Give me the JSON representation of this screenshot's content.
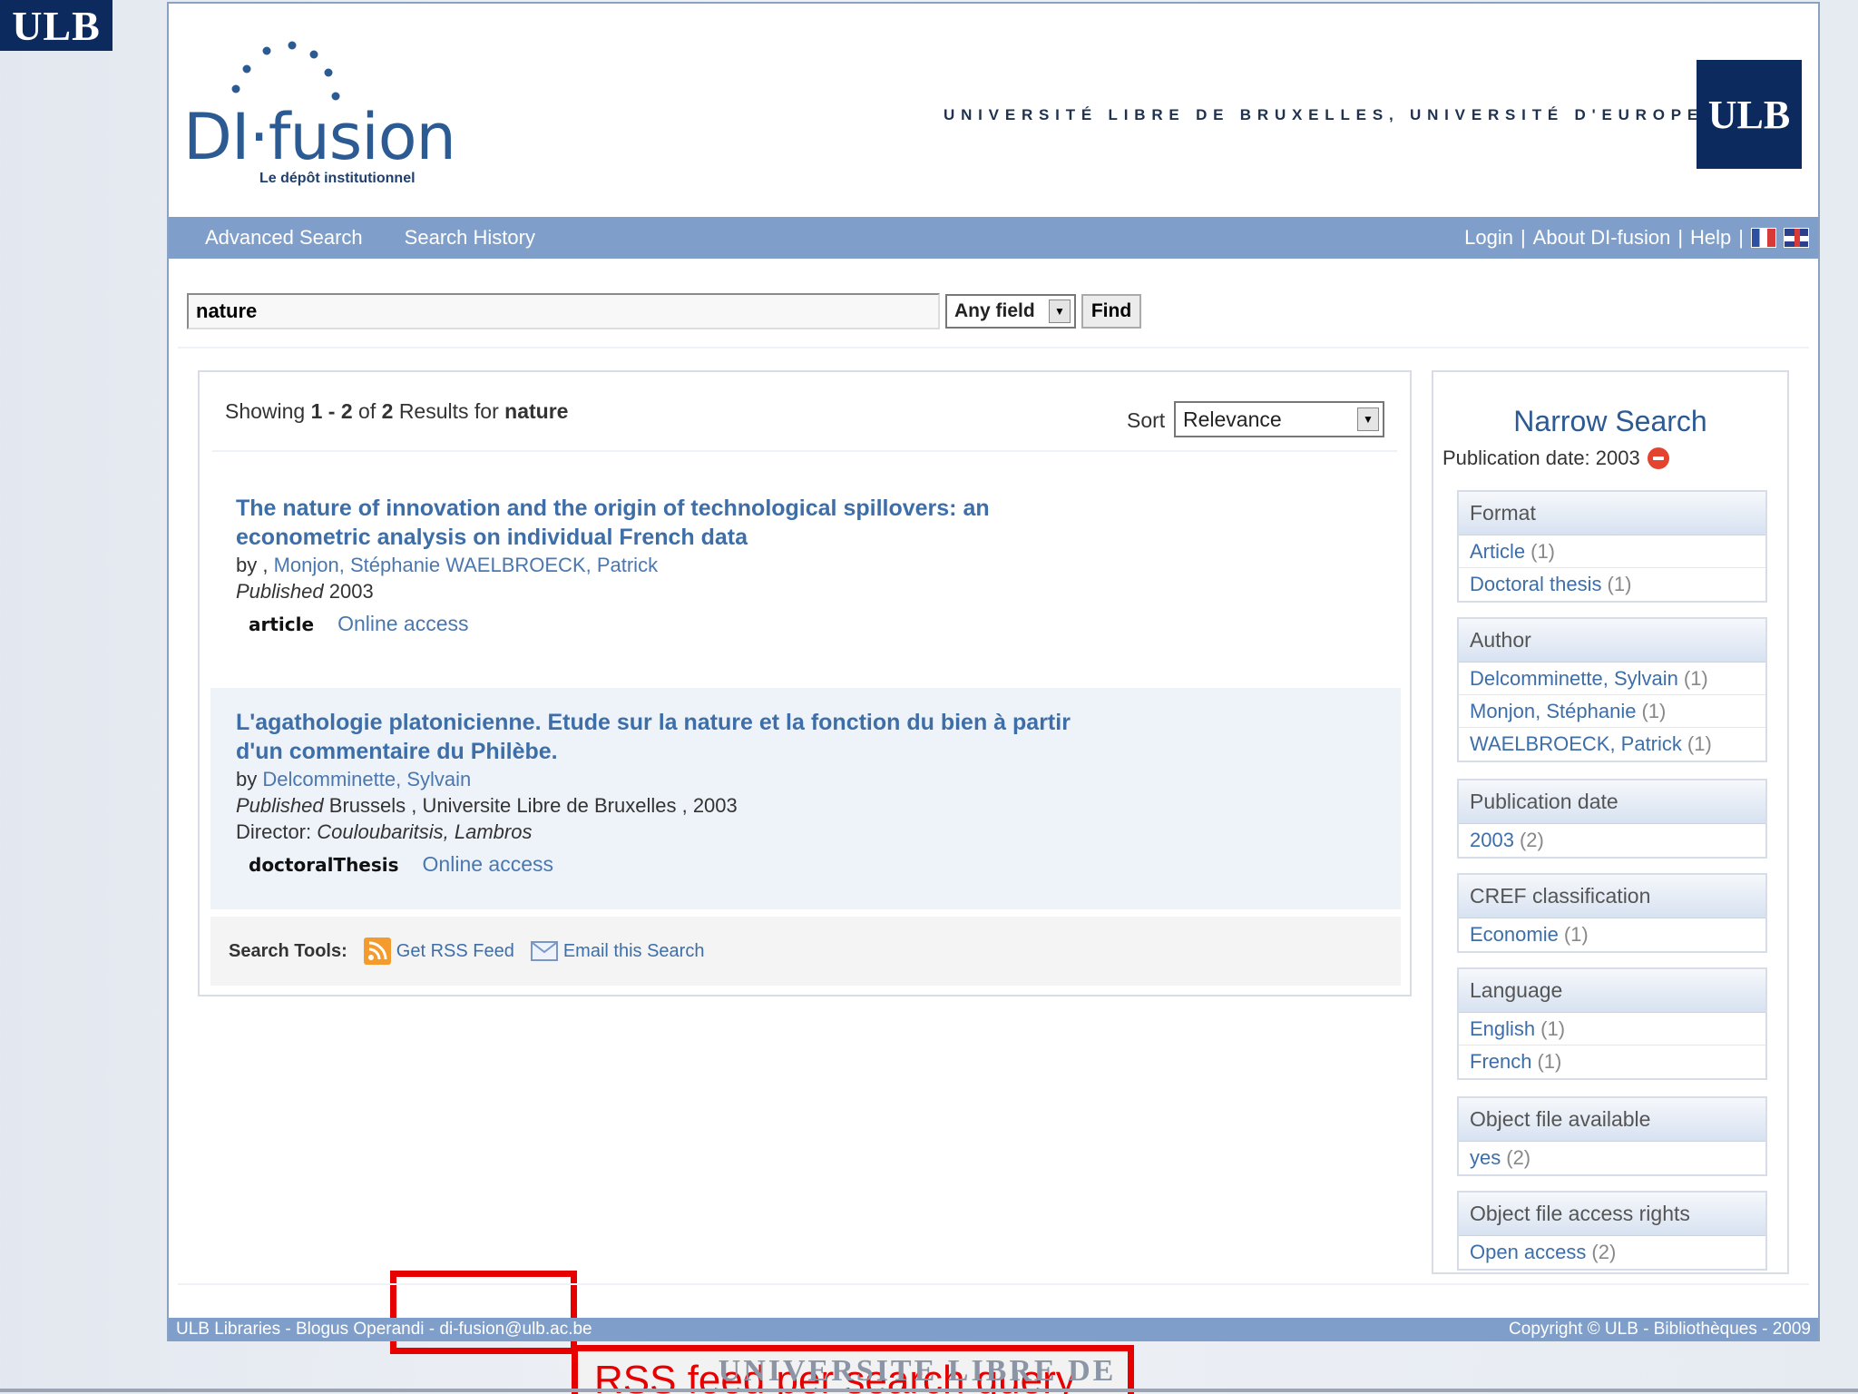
{
  "slide": {
    "corner_logo": "ULB",
    "bottom_text": "UNIVERSITE LIBRE DE BRUXELLES"
  },
  "header": {
    "brand_name": "DI·fusion",
    "brand_sub": "Le dépôt institutionnel",
    "university_text": "UNIVERSITÉ LIBRE DE BRUXELLES, UNIVERSITÉ D'EUROPE",
    "university_logo": "ULB"
  },
  "nav": {
    "left": [
      "Advanced Search",
      "Search History"
    ],
    "login": "Login",
    "about": "About DI-fusion",
    "help": "Help",
    "separator": "|"
  },
  "search": {
    "query": "nature",
    "field_select": "Any field",
    "find_label": "Find"
  },
  "results": {
    "showing_prefix": "Showing",
    "range": "1 - 2",
    "of_label": "of",
    "total": "2",
    "results_for": "Results for",
    "term": "nature",
    "sort_label": "Sort",
    "sort_value": "Relevance",
    "records": [
      {
        "title": "The nature of innovation and the origin of technological spillovers: an econometric analysis on individual French data",
        "by_label": "by ,",
        "authors": "Monjon, Stéphanie WAELBROECK, Patrick",
        "published_label": "Published",
        "published_value": "2003",
        "type": "article",
        "access": "Online access"
      },
      {
        "title": "L'agathologie platonicienne. Etude sur la nature et la fonction du bien à partir d'un commentaire du Philèbe.",
        "by_label": "by",
        "authors": "Delcomminette, Sylvain",
        "published_label": "Published",
        "published_value": "Brussels , Universite Libre de Bruxelles , 2003",
        "director_label": "Director:",
        "director_value": "Couloubaritsis, Lambros",
        "type": "doctoralThesis",
        "access": "Online access"
      }
    ],
    "tools_label": "Search Tools:",
    "rss_label": "Get RSS Feed",
    "email_label": "Email this Search"
  },
  "annotation": {
    "callout": "RSS feed per search query",
    "color": "#e60000"
  },
  "sidebar": {
    "title": "Narrow Search",
    "active_filter": "Publication date: 2003",
    "facets": [
      {
        "name": "Format",
        "items": [
          {
            "label": "Article",
            "count": "(1)"
          },
          {
            "label": "Doctoral thesis",
            "count": "(1)"
          }
        ]
      },
      {
        "name": "Author",
        "items": [
          {
            "label": "Delcomminette, Sylvain",
            "count": "(1)"
          },
          {
            "label": "Monjon, Stéphanie",
            "count": "(1)"
          },
          {
            "label": "WAELBROECK, Patrick",
            "count": "(1)"
          }
        ]
      },
      {
        "name": "Publication date",
        "items": [
          {
            "label": "2003",
            "count": "(2)"
          }
        ]
      },
      {
        "name": "CREF classification",
        "items": [
          {
            "label": "Economie",
            "count": "(1)"
          }
        ]
      },
      {
        "name": "Language",
        "items": [
          {
            "label": "English",
            "count": "(1)"
          },
          {
            "label": "French",
            "count": "(1)"
          }
        ]
      },
      {
        "name": "Object file available",
        "items": [
          {
            "label": "yes",
            "count": "(2)"
          }
        ]
      },
      {
        "name": "Object file access rights",
        "items": [
          {
            "label": "Open access",
            "count": "(2)"
          }
        ]
      }
    ]
  },
  "footer": {
    "left": "ULB Libraries - Blogus Operandi - di-fusion@ulb.ac.be",
    "right": "Copyright © ULB - Bibliothèques - 2009"
  },
  "colors": {
    "nav_bar": "#7f9fca",
    "link": "#3d6ea8",
    "ulb_navy": "#0d2a5e"
  }
}
